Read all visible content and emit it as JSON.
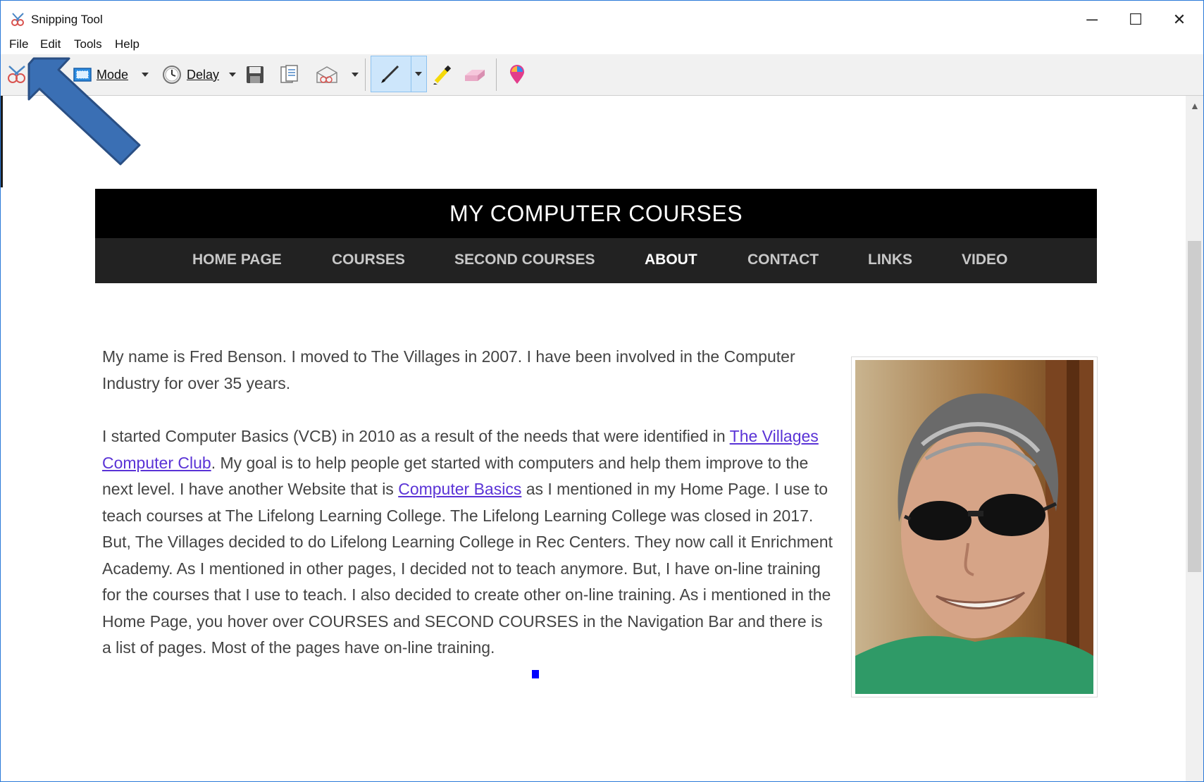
{
  "window": {
    "title": "Snipping Tool",
    "controls": {
      "minimize": "─",
      "maximize": "☐",
      "close": "✕"
    }
  },
  "menu": {
    "file": "File",
    "edit": "Edit",
    "tools": "Tools",
    "help": "Help"
  },
  "toolbar": {
    "mode_label": "Mode",
    "delay_label": "Delay"
  },
  "site": {
    "title": "MY COMPUTER COURSES",
    "nav": [
      "HOME PAGE",
      "COURSES",
      "SECOND COURSES",
      "ABOUT",
      "CONTACT",
      "LINKS",
      "VIDEO"
    ],
    "active_nav": "ABOUT",
    "intro": "My name is Fred Benson.  I moved to The Villages in 2007.  I have been involved in the Computer Industry for over 35 years.",
    "body_a": "I started Computer Basics (VCB) in 2010 as a result of the needs that were identified in ",
    "link_club": "The Villages Computer Club",
    "body_b": ".  My goal is to help people get started with computers and help them improve to the next level.  I have another Website that is ",
    "link_basics": "Computer Basics",
    "body_c": " as I mentioned in my Home Page.  I use to teach courses at The Lifelong Learning College.  The Lifelong Learning College was closed in 2017.  But, The Villages decided to do Lifelong Learning College in Rec Centers.  They now call it Enrichment Academy.  As I mentioned in other pages, I decided not to teach anymore.  But, I have on-line training for the courses that I use to teach.  I also decided to create other on-line training.  As i mentioned in the Home Page, you hover over COURSES and SECOND COURSES in the Navigation Bar and there is a list of pages.  Most of the pages have on-line training."
  },
  "colors": {
    "accent": "#2b79d8",
    "arrow": "#3a6fb4",
    "link": "#5a33d6",
    "nav_bg": "#222222",
    "header_bg": "#000000"
  },
  "icons": [
    "snipping-tool-icon",
    "new-snip-icon",
    "mode-icon",
    "delay-clock-icon",
    "save-icon",
    "copy-icon",
    "send-snip-icon",
    "pen-icon",
    "highlighter-icon",
    "eraser-icon",
    "paint3d-icon"
  ]
}
